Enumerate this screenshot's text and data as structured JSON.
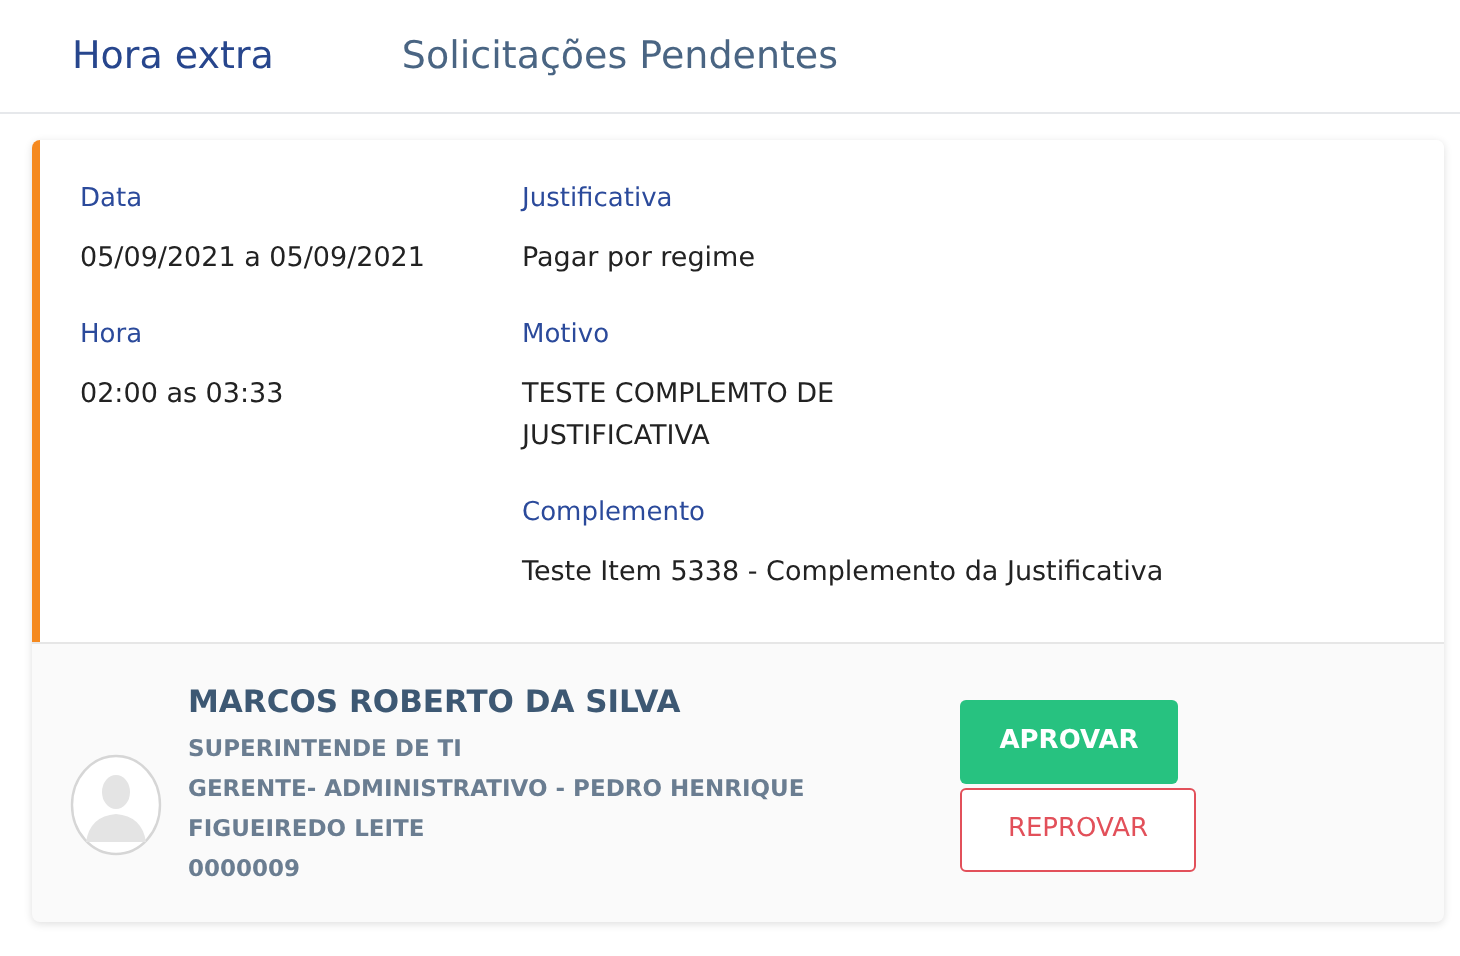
{
  "tabs": [
    {
      "label": "Hora extra",
      "selected": true
    },
    {
      "label": "Solicitações Pendentes",
      "selected": false
    }
  ],
  "request": {
    "columns": [
      [
        {
          "label": "Data",
          "value": "05/09/2021 a 05/09/2021"
        },
        {
          "label": "Hora",
          "value": "02:00 as 03:33"
        }
      ],
      [
        {
          "label": "Justificativa",
          "value": "Pagar por regime"
        },
        {
          "label": "Motivo",
          "value": "TESTE COMPLEMTO DE JUSTIFICATIVA"
        },
        {
          "label": "Complemento",
          "value": "Teste Item 5338 - Complemento da Justificativa"
        }
      ]
    ]
  },
  "requester": {
    "name": "MARCOS ROBERTO DA SILVA",
    "details": [
      "SUPERINTENDE DE TI",
      "GERENTE- ADMINISTRATIVO - PEDRO HENRIQUE FIGUEIREDO LEITE",
      "0000009"
    ]
  },
  "actions": [
    {
      "label": "APROVAR",
      "kind": "approve"
    },
    {
      "label": "REPROVAR",
      "kind": "reject"
    }
  ]
}
